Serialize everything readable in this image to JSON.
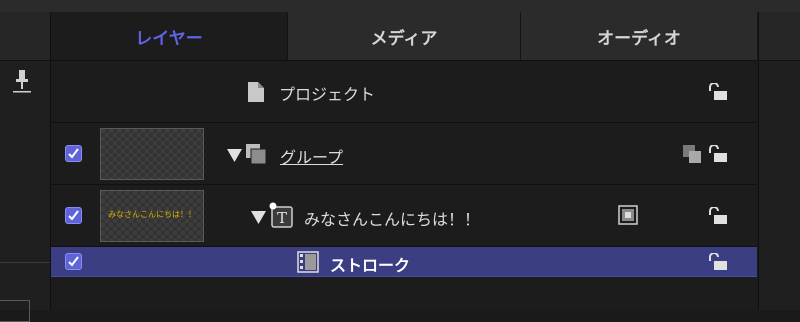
{
  "tabs": [
    {
      "label": "レイヤー",
      "active": true
    },
    {
      "label": "メディア",
      "active": false
    },
    {
      "label": "オーディオ",
      "active": false
    }
  ],
  "rows": [
    {
      "name": "プロジェクト",
      "type": "project",
      "icon": "document-icon",
      "locked": false
    },
    {
      "name": "グループ",
      "type": "group",
      "checked": true,
      "expanded": true,
      "icon": "group-icon",
      "locked": false
    },
    {
      "name": "みなさんこんにちは！！",
      "type": "text",
      "checked": true,
      "expanded": true,
      "icon": "text-layer-icon",
      "locked": false,
      "thumbnail_text": "みなさんこんにちは！！"
    },
    {
      "name": "ストローク",
      "type": "behavior",
      "checked": true,
      "selected": true,
      "icon": "filmstrip-icon",
      "locked": false
    }
  ],
  "colors": {
    "accent": "#5d66e8",
    "selection": "#3b3e82",
    "checkbox": "#5e63d9",
    "thumbnail_text": "#e0b400"
  }
}
